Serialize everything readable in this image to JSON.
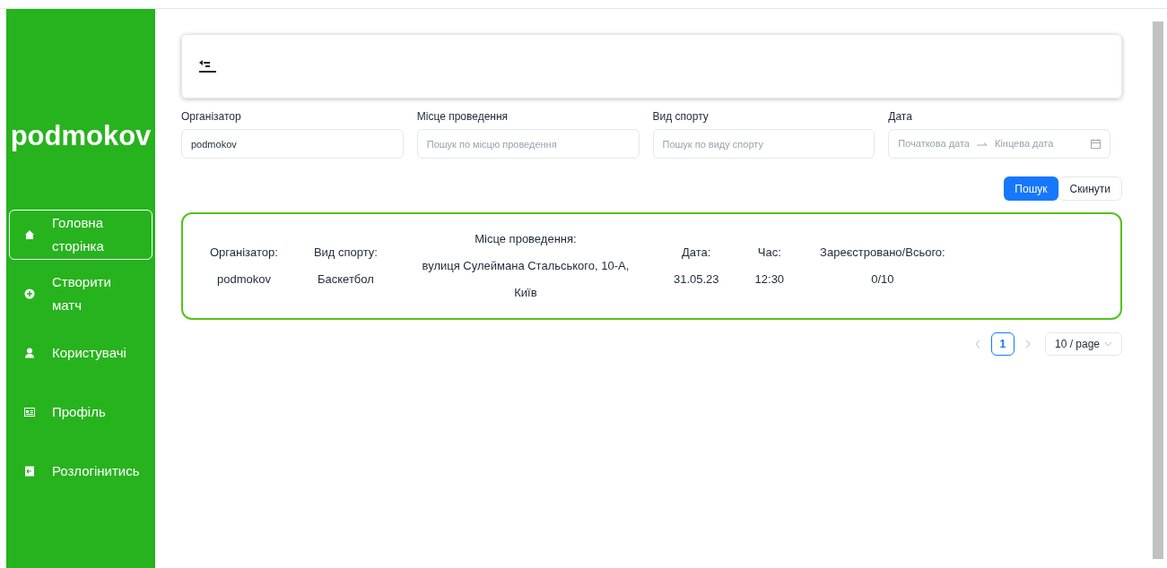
{
  "sidebar": {
    "brand": "podmokov",
    "items": [
      {
        "label": "Головна сторінка",
        "kind": "home",
        "selected": true
      },
      {
        "label": "Створити матч",
        "kind": "create",
        "selected": false
      },
      {
        "label": "Користувачі",
        "kind": "users",
        "selected": false
      },
      {
        "label": "Профіль",
        "kind": "profile",
        "selected": false
      },
      {
        "label": "Розлогінитись",
        "kind": "logout",
        "selected": false
      }
    ]
  },
  "filters": [
    {
      "kind": "text",
      "label": "Організатор",
      "value": "podmokov"
    },
    {
      "kind": "text",
      "label": "Місце проведення",
      "placeholder": "Пошук по місцю проведення"
    },
    {
      "kind": "text",
      "label": "Вид спорту",
      "placeholder": "Пошук по виду спорту"
    },
    {
      "kind": "range",
      "label": "Дата",
      "start_placeholder": "Початкова дата",
      "end_placeholder": "Кінцева дата"
    }
  ],
  "buttons": {
    "search": "Пошук",
    "reset": "Скинути"
  },
  "matches": [
    {
      "fields": [
        {
          "label": "Організатор:",
          "value": "podmokov"
        },
        {
          "label": "Вид спорту:",
          "value": "Баскетбол"
        },
        {
          "label": "Місце проведення:",
          "value": "вулиця Сулеймана Стальського, 10-А, Київ"
        },
        {
          "label": "Дата:",
          "value": "31.05.23"
        },
        {
          "label": "Час:",
          "value": "12:30"
        },
        {
          "label": "Зареєстровано/Всього:",
          "value": "0/10"
        }
      ]
    }
  ],
  "pagination": {
    "pages": [
      {
        "label": "1",
        "selected": true
      }
    ],
    "page_size": "10 / page"
  }
}
